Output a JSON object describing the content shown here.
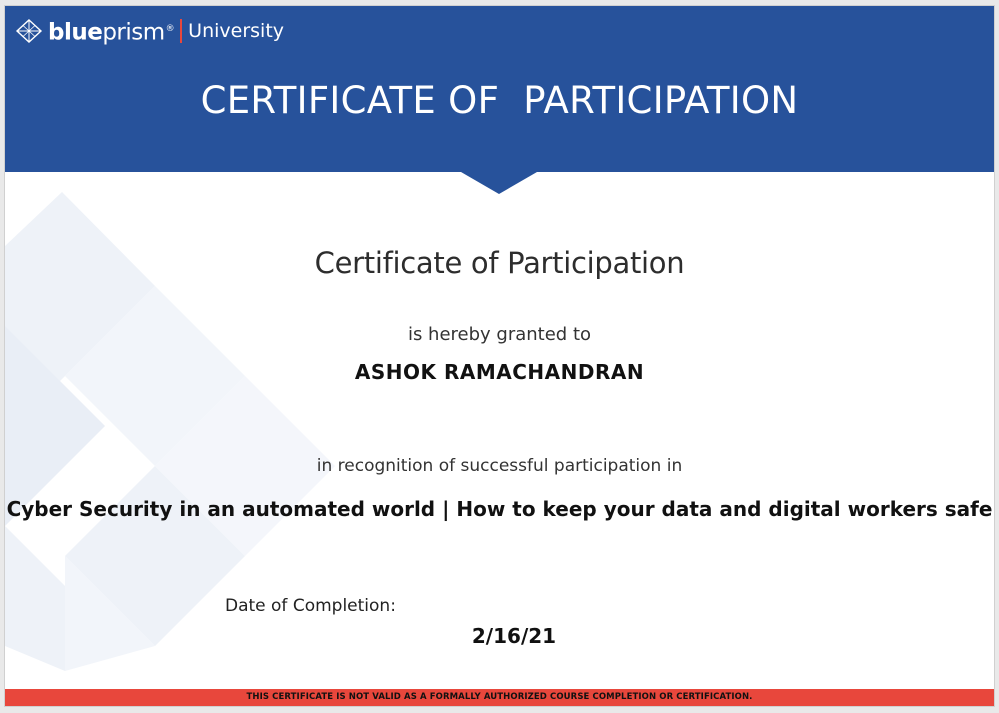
{
  "brand": {
    "name_bold": "blue",
    "name_light": "prism",
    "registered": "®",
    "sub": "University"
  },
  "header": {
    "title": "CERTIFICATE OF  PARTICIPATION"
  },
  "certificate": {
    "heading": "Certificate of Participation",
    "granted_text": "is hereby granted to",
    "recipient": "ASHOK RAMACHANDRAN",
    "recognition_text": "in recognition of successful participation in",
    "course_title": "Cyber Security in an automated world | How to keep your data and digital workers safe",
    "date_label": "Date of Completion:",
    "date_value": "2/16/21"
  },
  "footer": {
    "disclaimer": "THIS CERTIFICATE IS NOT VALID AS A FORMALLY AUTHORIZED COURSE COMPLETION OR CERTIFICATION."
  },
  "colors": {
    "header_blue": "#27529b",
    "footer_red": "#e8473c",
    "shape_light": "#eef2f8"
  }
}
